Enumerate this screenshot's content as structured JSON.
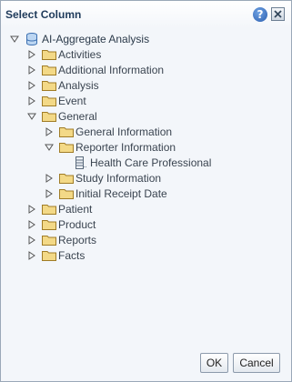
{
  "dialog": {
    "title": "Select Column"
  },
  "tree": {
    "root": "AI-Aggregate Analysis",
    "items": [
      {
        "label": "Activities"
      },
      {
        "label": "Additional Information"
      },
      {
        "label": "Analysis"
      },
      {
        "label": "Event"
      },
      {
        "label": "General"
      },
      {
        "label": "General Information"
      },
      {
        "label": "Reporter Information"
      },
      {
        "label": "Health Care Professional"
      },
      {
        "label": "Study Information"
      },
      {
        "label": "Initial Receipt Date"
      },
      {
        "label": "Patient"
      },
      {
        "label": "Product"
      },
      {
        "label": "Reports"
      },
      {
        "label": "Facts"
      }
    ]
  },
  "buttons": {
    "ok": "OK",
    "cancel": "Cancel"
  },
  "colors": {
    "folder": "#e9c868",
    "accent": "#1f3b5b"
  }
}
